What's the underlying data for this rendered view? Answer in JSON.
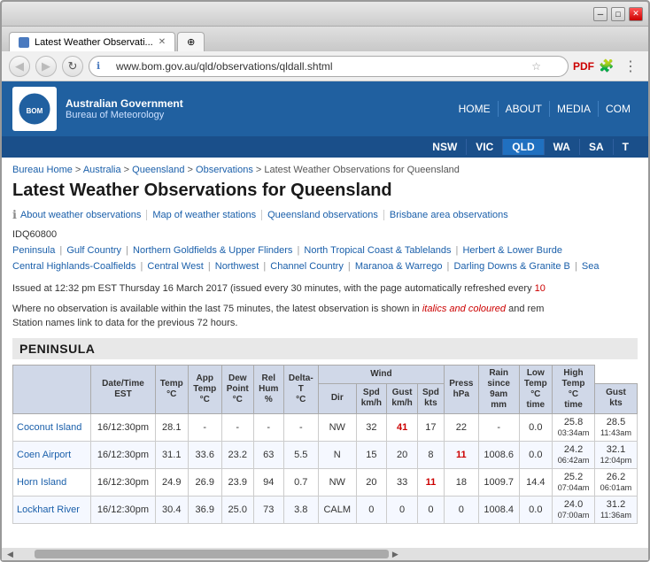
{
  "browser": {
    "tab_title": "Latest Weather Observati...",
    "url": "www.bom.gov.au/qld/observations/qldall.shtml",
    "nav_back": "◀",
    "nav_forward": "▶",
    "nav_refresh": "↻"
  },
  "header": {
    "govt": "Australian Government",
    "bureau": "Bureau of Meteorology",
    "nav_items": [
      "HOME",
      "ABOUT",
      "MEDIA",
      "COM"
    ],
    "state_items": [
      "NSW",
      "VIC",
      "QLD",
      "WA",
      "SA",
      "T"
    ]
  },
  "breadcrumb": {
    "items": [
      "Bureau Home",
      "Australia",
      "Queensland",
      "Observations"
    ],
    "current": "Latest Weather Observations for Queensland"
  },
  "page": {
    "title": "Latest Weather Observations for Queensland",
    "info_links": [
      "About weather observations",
      "Map of weather stations",
      "Queensland observations",
      "Brisbane area observations"
    ],
    "idc": "IDQ60800",
    "regions": [
      "Peninsula",
      "Gulf Country",
      "Northern Goldfields & Upper Flinders",
      "North Tropical Coast & Tablelands",
      "Herbert & Lower Burde",
      "Central Highlands-Coalfields",
      "Central West",
      "Northwest",
      "Channel Country",
      "Maranoa & Warrego",
      "Darling Downs & Granite B",
      "Sea"
    ],
    "issue_notice": "Issued at 12:32 pm EST Thursday 16 March 2017 (issued every 30 minutes, with the page automatically refreshed every 10",
    "obs_note_1": "Where no observation is available within the last 75 minutes, the latest observation is shown in",
    "obs_note_italic": "italics and coloured",
    "obs_note_2": "and rem",
    "obs_note_3": "Station names link to data for the previous 72 hours.",
    "section": "PENINSULA"
  },
  "table": {
    "headers": {
      "station": "",
      "datetime": "Date/Time EST",
      "temp": "Temp °C",
      "app_temp": "App Temp °C",
      "dew_point": "Dew Point °C",
      "rel_hum": "Rel Hum %",
      "delta_t": "Delta-T °C",
      "wind": "Wind",
      "wind_dir": "Dir",
      "wind_spd": "Spd km/h",
      "wind_gust": "Gust km/h",
      "wind_spd_kts": "Spd kts",
      "wind_gust_kts": "Gust kts",
      "press": "Press hPa",
      "rain": "Rain since 9am mm",
      "low_temp": "Low Temp °C time",
      "high_temp": "High Temp °C time"
    },
    "rows": [
      {
        "station": "Coconut Island",
        "datetime": "16/12:30pm",
        "temp": "28.1",
        "app_temp": "-",
        "dew_point": "-",
        "rel_hum": "-",
        "delta_t": "-",
        "wind_dir": "NW",
        "wind_spd": "32",
        "wind_gust": "41",
        "wind_gust_highlight": true,
        "wind_spd_kts": "17",
        "wind_gust_kts": "22",
        "wind_gust_kts_highlight": false,
        "press": "-",
        "rain": "0.0",
        "low_temp": "25.8",
        "low_time": "03:34am",
        "high_temp": "28.5",
        "high_time": "11:43am"
      },
      {
        "station": "Coen Airport",
        "datetime": "16/12:30pm",
        "temp": "31.1",
        "app_temp": "33.6",
        "dew_point": "23.2",
        "rel_hum": "63",
        "delta_t": "5.5",
        "wind_dir": "N",
        "wind_spd": "15",
        "wind_gust": "20",
        "wind_gust_highlight": false,
        "wind_spd_kts": "8",
        "wind_gust_kts": "11",
        "wind_gust_kts_highlight": true,
        "press": "1008.6",
        "rain": "0.0",
        "low_temp": "24.2",
        "low_time": "06:42am",
        "high_temp": "32.1",
        "high_time": "12:04pm"
      },
      {
        "station": "Horn Island",
        "datetime": "16/12:30pm",
        "temp": "24.9",
        "app_temp": "26.9",
        "dew_point": "23.9",
        "rel_hum": "94",
        "delta_t": "0.7",
        "wind_dir": "NW",
        "wind_spd": "20",
        "wind_gust": "33",
        "wind_gust_highlight": false,
        "wind_spd_kts": "11",
        "wind_gust_kts": "18",
        "wind_gust_kts_highlight": false,
        "press": "1009.7",
        "rain": "14.4",
        "low_temp": "25.2",
        "low_time": "07:04am",
        "high_temp": "26.2",
        "high_time": "06:01am"
      },
      {
        "station": "Lockhart River",
        "datetime": "16/12:30pm",
        "temp": "30.4",
        "app_temp": "36.9",
        "dew_point": "25.0",
        "rel_hum": "73",
        "delta_t": "3.8",
        "wind_dir": "CALM",
        "wind_spd": "0",
        "wind_gust": "0",
        "wind_gust_highlight": false,
        "wind_spd_kts": "0",
        "wind_gust_kts": "0",
        "wind_gust_kts_highlight": false,
        "press": "1008.4",
        "rain": "0.0",
        "low_temp": "24.0",
        "low_time": "07:00am",
        "high_temp": "31.2",
        "high_time": "11:36am"
      }
    ]
  }
}
